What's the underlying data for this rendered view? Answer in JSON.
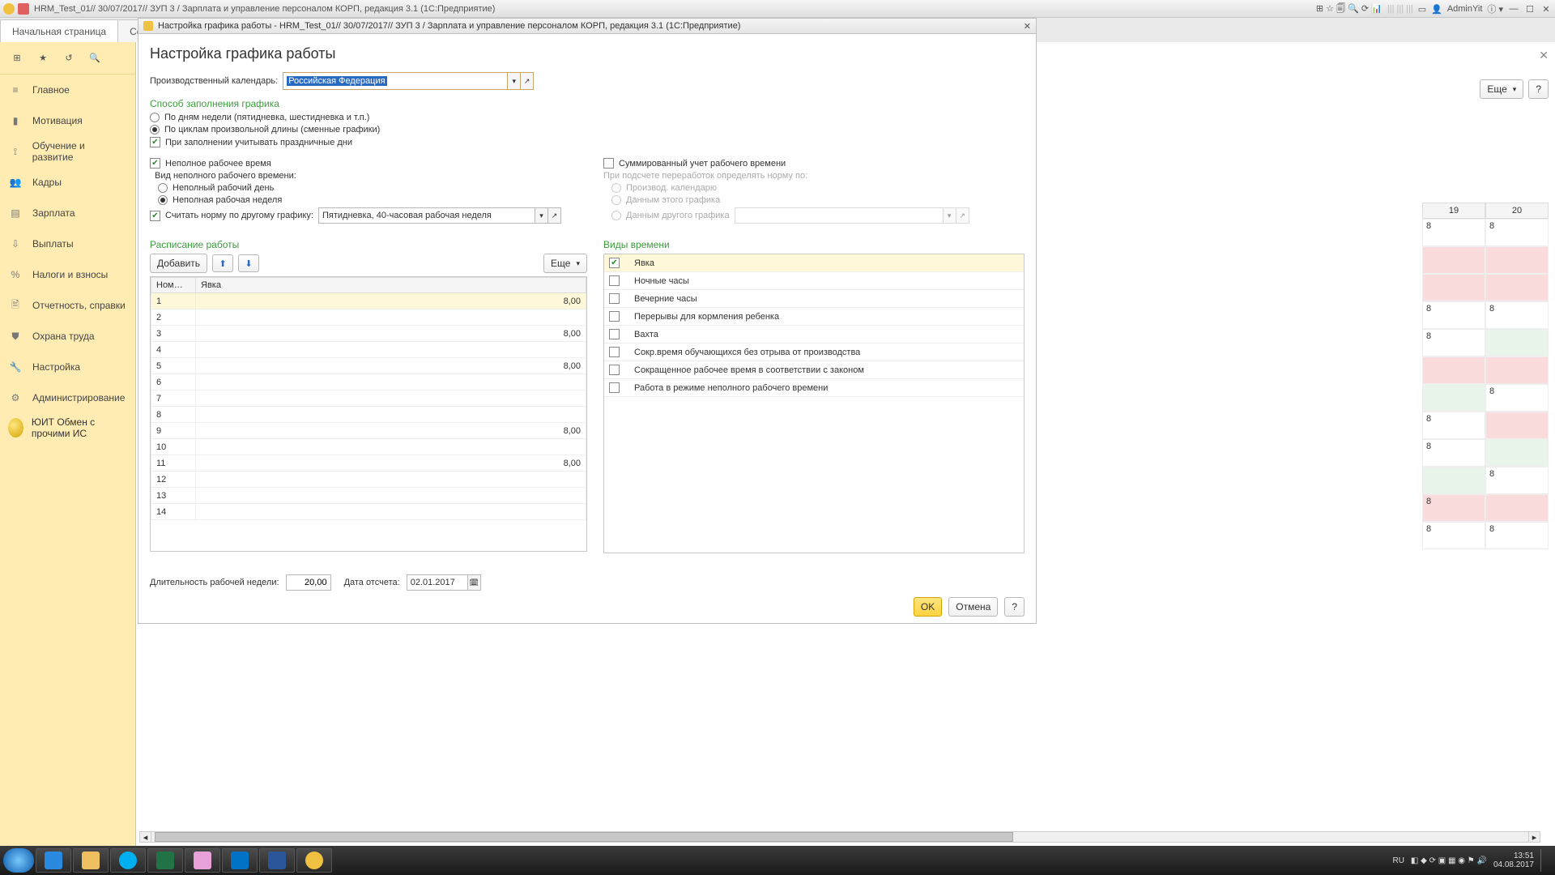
{
  "titlebar": {
    "title": "HRM_Test_01// 30/07/2017// ЗУП 3 / Зарплата и управление персоналом КОРП, редакция 3.1  (1С:Предприятие)",
    "user": "AdminYit"
  },
  "tabs": {
    "home": "Начальная страница",
    "employees": "Сотрудн"
  },
  "sidebar": {
    "items": [
      {
        "icon": "≡",
        "label": "Главное"
      },
      {
        "icon": "▮",
        "label": "Мотивация"
      },
      {
        "icon": "⟟",
        "label": "Обучение и развитие"
      },
      {
        "icon": "👥",
        "label": "Кадры"
      },
      {
        "icon": "▤",
        "label": "Зарплата"
      },
      {
        "icon": "⇩",
        "label": "Выплаты"
      },
      {
        "icon": "%",
        "label": "Налоги и взносы"
      },
      {
        "icon": "🖹",
        "label": "Отчетность, справки"
      },
      {
        "icon": "⛊",
        "label": "Охрана труда"
      },
      {
        "icon": "🔧",
        "label": "Настройка"
      },
      {
        "icon": "⚙",
        "label": "Администрирование"
      }
    ],
    "special": "ЮИТ Обмен с прочими ИС"
  },
  "right_buttons": {
    "more": "Еще",
    "help": "?"
  },
  "dialog": {
    "wintitle": "Настройка графика работы - HRM_Test_01// 30/07/2017// ЗУП 3 / Зарплата и управление персоналом КОРП, редакция 3.1  (1С:Предприятие)",
    "heading": "Настройка графика работы",
    "calendar_label": "Производственный календарь:",
    "calendar_value": "Российская Федерация",
    "sec_fill": "Способ заполнения графика",
    "opt_weekdays": "По дням недели (пятидневка, шестидневка и т.п.)",
    "opt_cycles": "По циклам произвольной длины (сменные графики)",
    "opt_holidays": "При заполнении учитывать праздничные дни",
    "chk_parttime": "Неполное рабочее время",
    "parttime_kind": "Вид неполного рабочего времени:",
    "opt_partday": "Неполный рабочий день",
    "opt_partweek": "Неполная рабочая неделя",
    "chk_norm": "Считать норму по другому графику:",
    "norm_value": "Пятидневка, 40-часовая рабочая неделя",
    "chk_sum": "Суммированный учет рабочего времени",
    "overtime_label": "При подсчете переработок определять норму по:",
    "opt_prodcal": "Производ. календарю",
    "opt_thischart": "Данным этого графика",
    "opt_otherchart": "Данным другого графика",
    "sec_schedule": "Расписание работы",
    "btn_add": "Добавить",
    "btn_more": "Еще",
    "col_num": "Ном…",
    "col_yavka": "Явка",
    "rows": [
      {
        "n": "1",
        "v": "8,00"
      },
      {
        "n": "2",
        "v": ""
      },
      {
        "n": "3",
        "v": "8,00"
      },
      {
        "n": "4",
        "v": ""
      },
      {
        "n": "5",
        "v": "8,00"
      },
      {
        "n": "6",
        "v": ""
      },
      {
        "n": "7",
        "v": ""
      },
      {
        "n": "8",
        "v": ""
      },
      {
        "n": "9",
        "v": "8,00"
      },
      {
        "n": "10",
        "v": ""
      },
      {
        "n": "11",
        "v": "8,00"
      },
      {
        "n": "12",
        "v": ""
      },
      {
        "n": "13",
        "v": ""
      },
      {
        "n": "14",
        "v": ""
      }
    ],
    "sec_time": "Виды времени",
    "timetypes": [
      {
        "chk": true,
        "label": "Явка"
      },
      {
        "chk": false,
        "label": "Ночные часы"
      },
      {
        "chk": false,
        "label": "Вечерние часы"
      },
      {
        "chk": false,
        "label": "Перерывы для кормления ребенка"
      },
      {
        "chk": false,
        "label": "Вахта"
      },
      {
        "chk": false,
        "label": "Сокр.время обучающихся без отрыва от производства"
      },
      {
        "chk": false,
        "label": "Сокращенное рабочее время в соответствии с законом"
      },
      {
        "chk": false,
        "label": "Работа в режиме неполного рабочего времени"
      }
    ],
    "weeklen_label": "Длительность рабочей недели:",
    "weeklen_value": "20,00",
    "startdate_label": "Дата отсчета:",
    "startdate_value": "02.01.2017",
    "ok": "OK",
    "cancel": "Отмена",
    "help": "?"
  },
  "bg_grid": {
    "headers": [
      "19",
      "20"
    ],
    "rows": [
      [
        "8",
        "8"
      ],
      [
        "",
        ""
      ],
      [
        "",
        ""
      ],
      [
        "8",
        "8"
      ],
      [
        "8",
        ""
      ],
      [
        "",
        ""
      ],
      [
        "",
        "8"
      ],
      [
        "8",
        ""
      ],
      [
        "8",
        ""
      ],
      [
        "",
        "8"
      ],
      [
        "8",
        ""
      ],
      [
        "8",
        "8"
      ]
    ],
    "colors": [
      [
        "",
        ""
      ],
      [
        "pink",
        "pink"
      ],
      [
        "pink",
        "pink"
      ],
      [
        "",
        ""
      ],
      [
        "",
        "grn"
      ],
      [
        "pink",
        "pink"
      ],
      [
        "grn",
        ""
      ],
      [
        "",
        "pink"
      ],
      [
        "",
        "grn"
      ],
      [
        "grn",
        ""
      ],
      [
        "pink",
        "pink"
      ],
      [
        "",
        ""
      ]
    ]
  },
  "tray": {
    "lang": "RU",
    "time": "13:51",
    "date": "04.08.2017"
  }
}
